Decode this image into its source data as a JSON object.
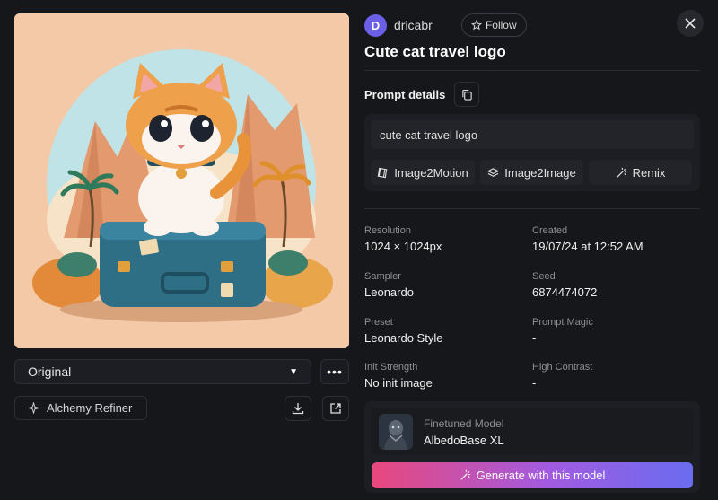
{
  "image": {
    "alt": ""
  },
  "variant_select": {
    "value": "Original"
  },
  "more_label": "•••",
  "alchemy": {
    "label": "Alchemy Refiner"
  },
  "user": {
    "initial": "D",
    "name": "dricabr",
    "follow_label": "Follow"
  },
  "title": "Cute cat travel logo",
  "prompt": {
    "heading": "Prompt details",
    "text": "cute cat travel logo",
    "actions": [
      {
        "label": "Image2Motion",
        "icon": "motion-icon"
      },
      {
        "label": "Image2Image",
        "icon": "layers-icon"
      },
      {
        "label": "Remix",
        "icon": "magic-wand-icon"
      }
    ]
  },
  "meta": {
    "resolution": {
      "label": "Resolution",
      "value": "1024 × 1024px"
    },
    "created": {
      "label": "Created",
      "value": "19/07/24 at 12:52 AM"
    },
    "sampler": {
      "label": "Sampler",
      "value": "Leonardo"
    },
    "seed": {
      "label": "Seed",
      "value": "6874474072"
    },
    "preset": {
      "label": "Preset",
      "value": "Leonardo Style"
    },
    "prompt_magic": {
      "label": "Prompt Magic",
      "value": "-"
    },
    "init_strength": {
      "label": "Init Strength",
      "value": "No init image"
    },
    "high_contrast": {
      "label": "High Contrast",
      "value": "-"
    }
  },
  "model": {
    "label": "Finetuned Model",
    "name": "AlbedoBase XL",
    "generate_label": "Generate with this model"
  },
  "colors": {
    "background": "#16171a",
    "accent_avatar": "#6b5fe6",
    "gradient_start": "#e9487d",
    "gradient_end": "#6a6cf0"
  }
}
